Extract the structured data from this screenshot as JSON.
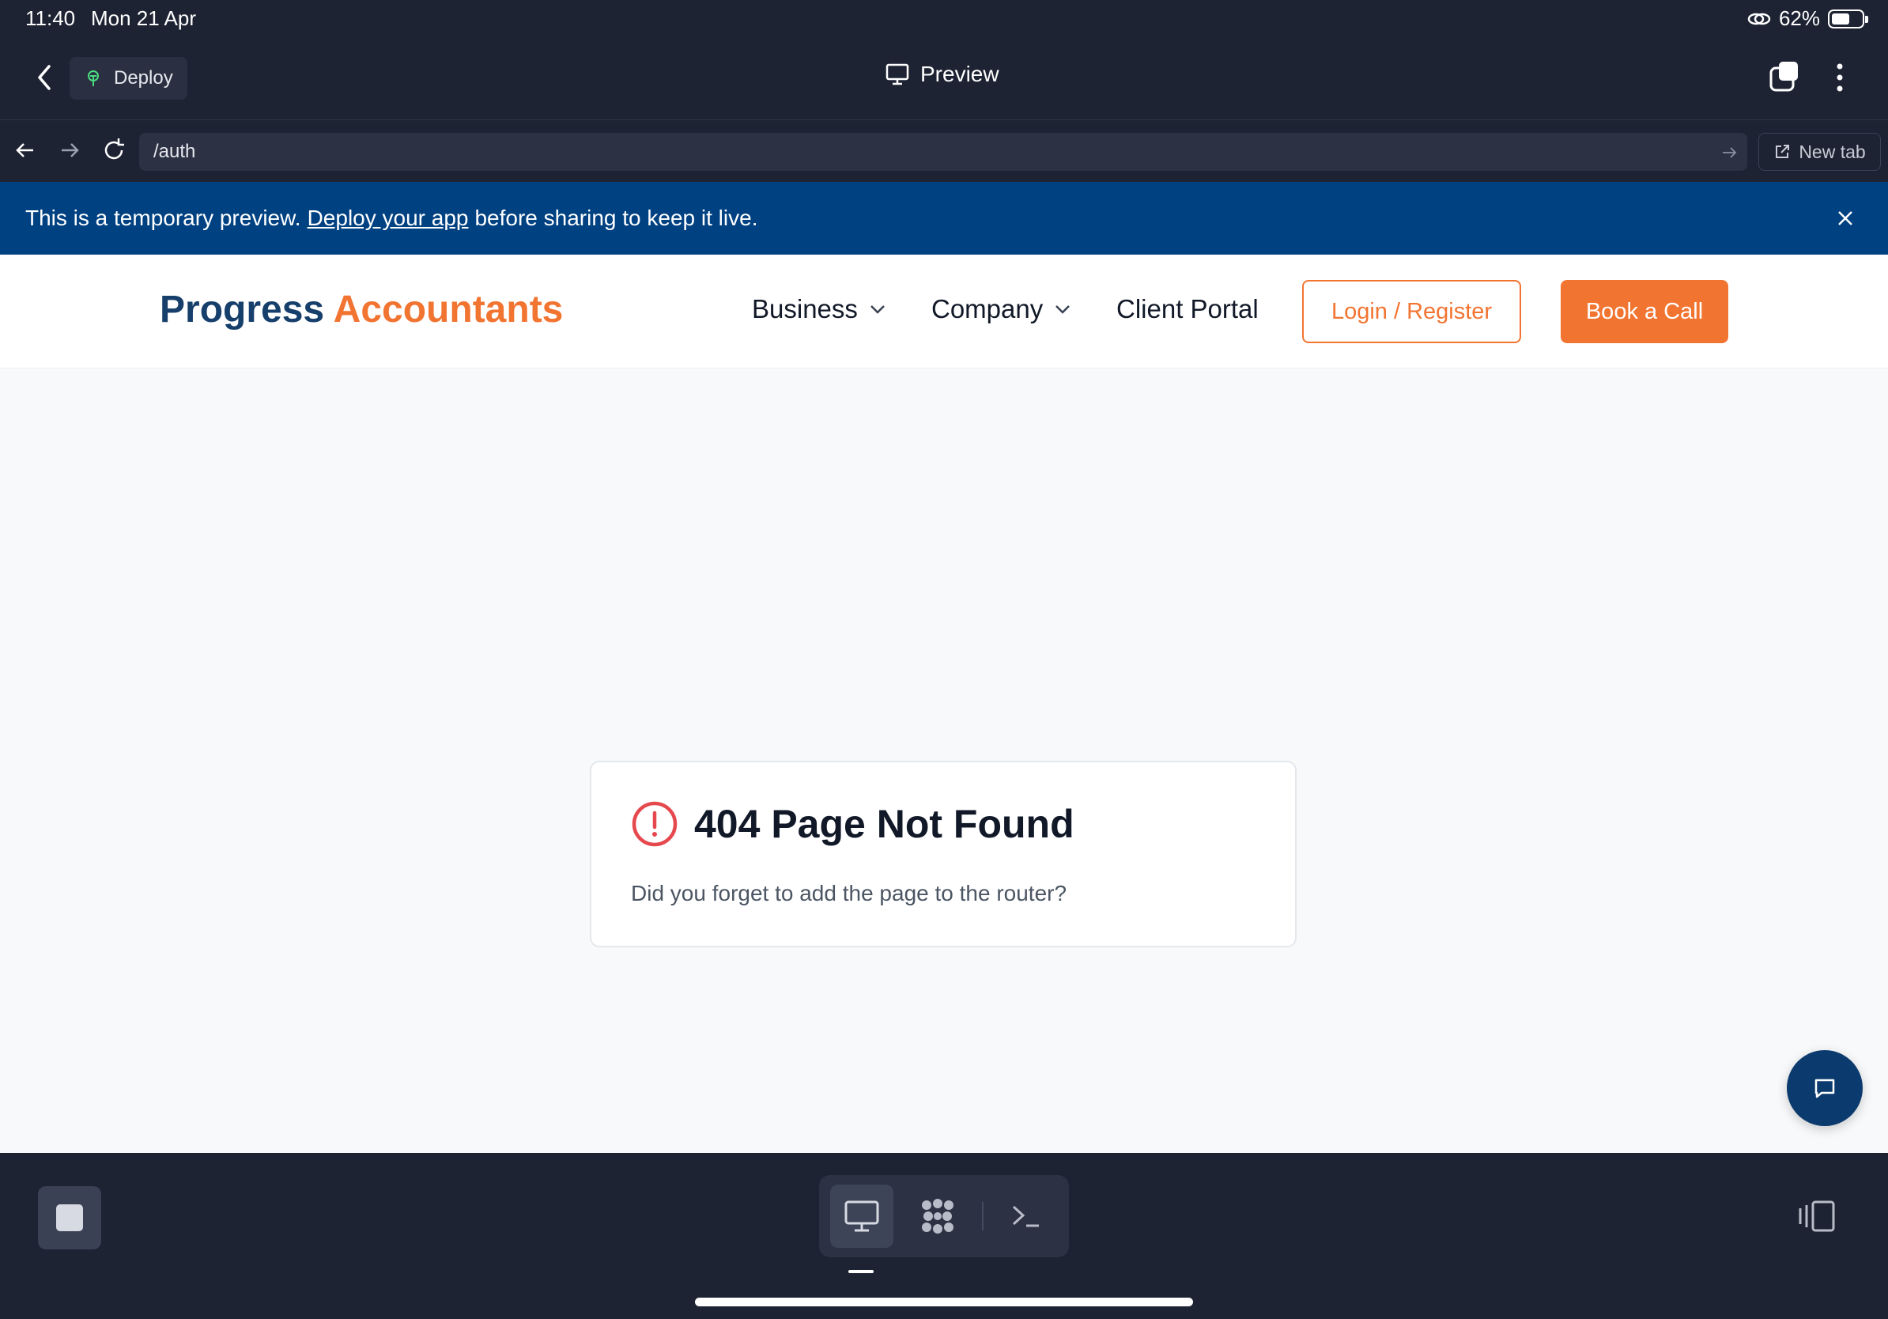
{
  "status_bar": {
    "time": "11:40",
    "date": "Mon 21 Apr",
    "battery": "62%"
  },
  "app_bar": {
    "deploy_label": "Deploy",
    "title": "Preview"
  },
  "browser": {
    "url": "/auth",
    "new_tab_label": "New tab"
  },
  "banner": {
    "text_before": "This is a temporary preview.",
    "link_text": "Deploy your app",
    "text_after": "before sharing to keep it live."
  },
  "site": {
    "logo_part1": "Progress",
    "logo_part2": "Accountants",
    "nav": {
      "business": "Business",
      "company": "Company",
      "client_portal": "Client Portal"
    },
    "login_label": "Login / Register",
    "book_label": "Book a Call"
  },
  "error": {
    "title": "404 Page Not Found",
    "message": "Did you forget to add the page to the router?"
  },
  "colors": {
    "brand_navy": "#173f6b",
    "brand_orange": "#f27431",
    "banner_blue": "#004182",
    "error_red": "#e5484d"
  }
}
